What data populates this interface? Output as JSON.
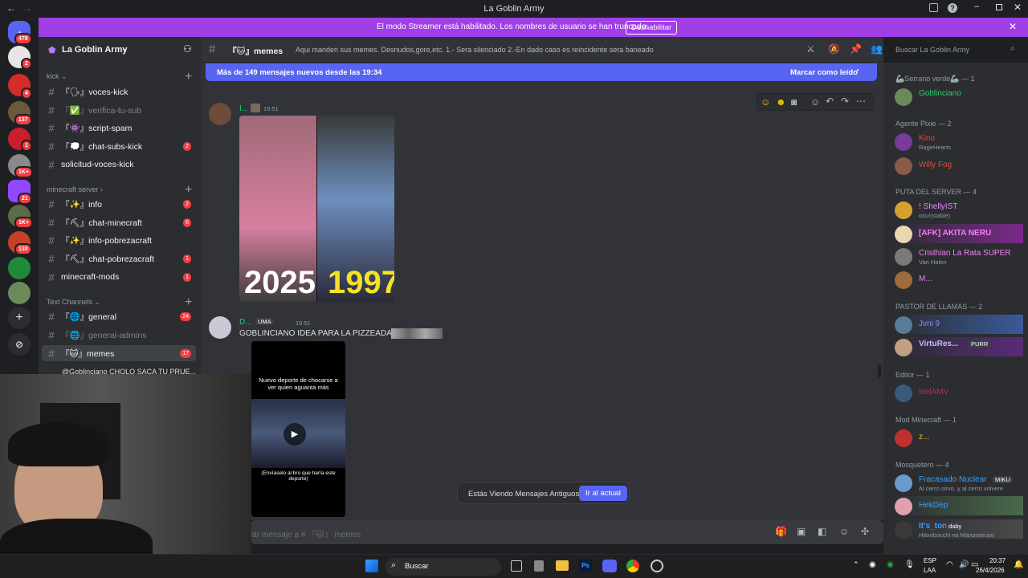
{
  "window": {
    "title": "La Goblin Army"
  },
  "banner": {
    "text": "El modo Streamer está habilitado. Los nombres de usuario se han truncado.",
    "button": "Deshabilitar"
  },
  "rail": {
    "badges": [
      "478",
      "2",
      "4",
      "137",
      "1",
      "1K+",
      "21",
      "1K+",
      "130"
    ]
  },
  "guild": {
    "name": "La Goblin Army"
  },
  "categories": {
    "kick": "kick",
    "mc": "minecraft server",
    "text": "Text Channels"
  },
  "channels": [
    {
      "label": "『🗣』voces-kick",
      "count": ""
    },
    {
      "label": "『✅』verifica-tu-sub",
      "count": ""
    },
    {
      "label": "『👾』script-spam",
      "count": ""
    },
    {
      "label": "『💭』chat-subs-kick",
      "count": "2"
    },
    {
      "label": "solicitud-voces-kick",
      "count": ""
    },
    {
      "label": "『✨』info",
      "count": "2"
    },
    {
      "label": "『⛏』chat-minecraft",
      "count": "6"
    },
    {
      "label": "『✨』info-pobrezacraft",
      "count": ""
    },
    {
      "label": "『⛏』chat-pobrezacraft",
      "count": "1"
    },
    {
      "label": "minecraft-mods",
      "count": "1"
    },
    {
      "label": "『🌐』general",
      "count": "24"
    },
    {
      "label": "『🌐』general-admins",
      "count": ""
    },
    {
      "label": "『🐱』memes",
      "count": "17"
    }
  ],
  "thread": {
    "label": "@Goblinciano CHOLO SACA TU PRUE..."
  },
  "header": {
    "channel": "『🐱』memes",
    "topic": "Aqui manden sus memes. Desnudos,gore,etc. 1.- Sera silenciado 2.-En dado caso es reincidente sera baneado",
    "search_placeholder": "Buscar La Goblin Army"
  },
  "newbar": {
    "text": "Más de 149 mensajes nuevos desde las 19:34",
    "action": "Marcar como leído"
  },
  "messages": [
    {
      "author": "I...",
      "time": "19:51",
      "image_labels": [
        "2025",
        "1997"
      ]
    },
    {
      "author": "D...",
      "tag": "UMA",
      "time": "19:51",
      "text": "GOBLINCIANO IDEA PARA LA PIZZEADA",
      "video_caption": "Nuevo deporte de chocarse a ver quien aguanta más",
      "video_footer": "(Envíaselo al bro que haría este deporte)"
    }
  ],
  "older": {
    "text": "Estás Viendo Mensajes Antiguos",
    "button": "Ir al actual"
  },
  "composer": {
    "placeholder": "iar mensaje a # 『🐱』 memes"
  },
  "members": {
    "groups": [
      "🦾Serrano verde🦾 — 1",
      "Agente Pixie — 2",
      "PUTA DEL SERVER — 4",
      "PASTOR DE LLAMAS — 2",
      "Editor — 1",
      "Mod Minecraft — 1",
      "Mosquetero — 4"
    ],
    "list": [
      {
        "name": "Goblinciano",
        "sub": "",
        "color": "#2ecc71"
      },
      {
        "name": "Kino",
        "sub": "RageHearts",
        "color": "#e74c3c"
      },
      {
        "name": "Willy Fog",
        "sub": "",
        "color": "#e74c3c"
      },
      {
        "name": "! ShellyIST",
        "sub": "osu!(stable)",
        "color": "#f47fff"
      },
      {
        "name": "[AFK] AKITA NERU",
        "sub": "",
        "color": "#f47fff"
      },
      {
        "name": "Cristhian La Rata SUPER",
        "sub": "Van Halen",
        "color": "#f47fff"
      },
      {
        "name": "M...",
        "sub": "",
        "color": "#f47fff"
      },
      {
        "name": "Jvni 9",
        "sub": "",
        "color": "#9b84ff"
      },
      {
        "name": "VirtuRes...",
        "sub": "",
        "tag": "PURR",
        "color": "#c9b8ff"
      },
      {
        "name": "ldelAMV",
        "sub": "",
        "color": "#a83262"
      },
      {
        "name": "z...",
        "sub": "",
        "color": "#f1c40f"
      },
      {
        "name": "Fracasado Nuclear",
        "sub": "Al cerro sirvo, y al cerro volvere",
        "tag": "MIKU",
        "color": "#3aa0ff"
      },
      {
        "name": "HekDep",
        "sub": "",
        "color": "#3aa0ff"
      },
      {
        "name": "It's_tony",
        "sub": "Hitoribocchi no Marumaruse",
        "tag": "daby",
        "color": "#3aa0ff"
      }
    ]
  },
  "taskbar": {
    "search": "Buscar",
    "lang": "ESP",
    "lang2": "LAA",
    "time": "20:37",
    "date": "26/4/2026"
  }
}
